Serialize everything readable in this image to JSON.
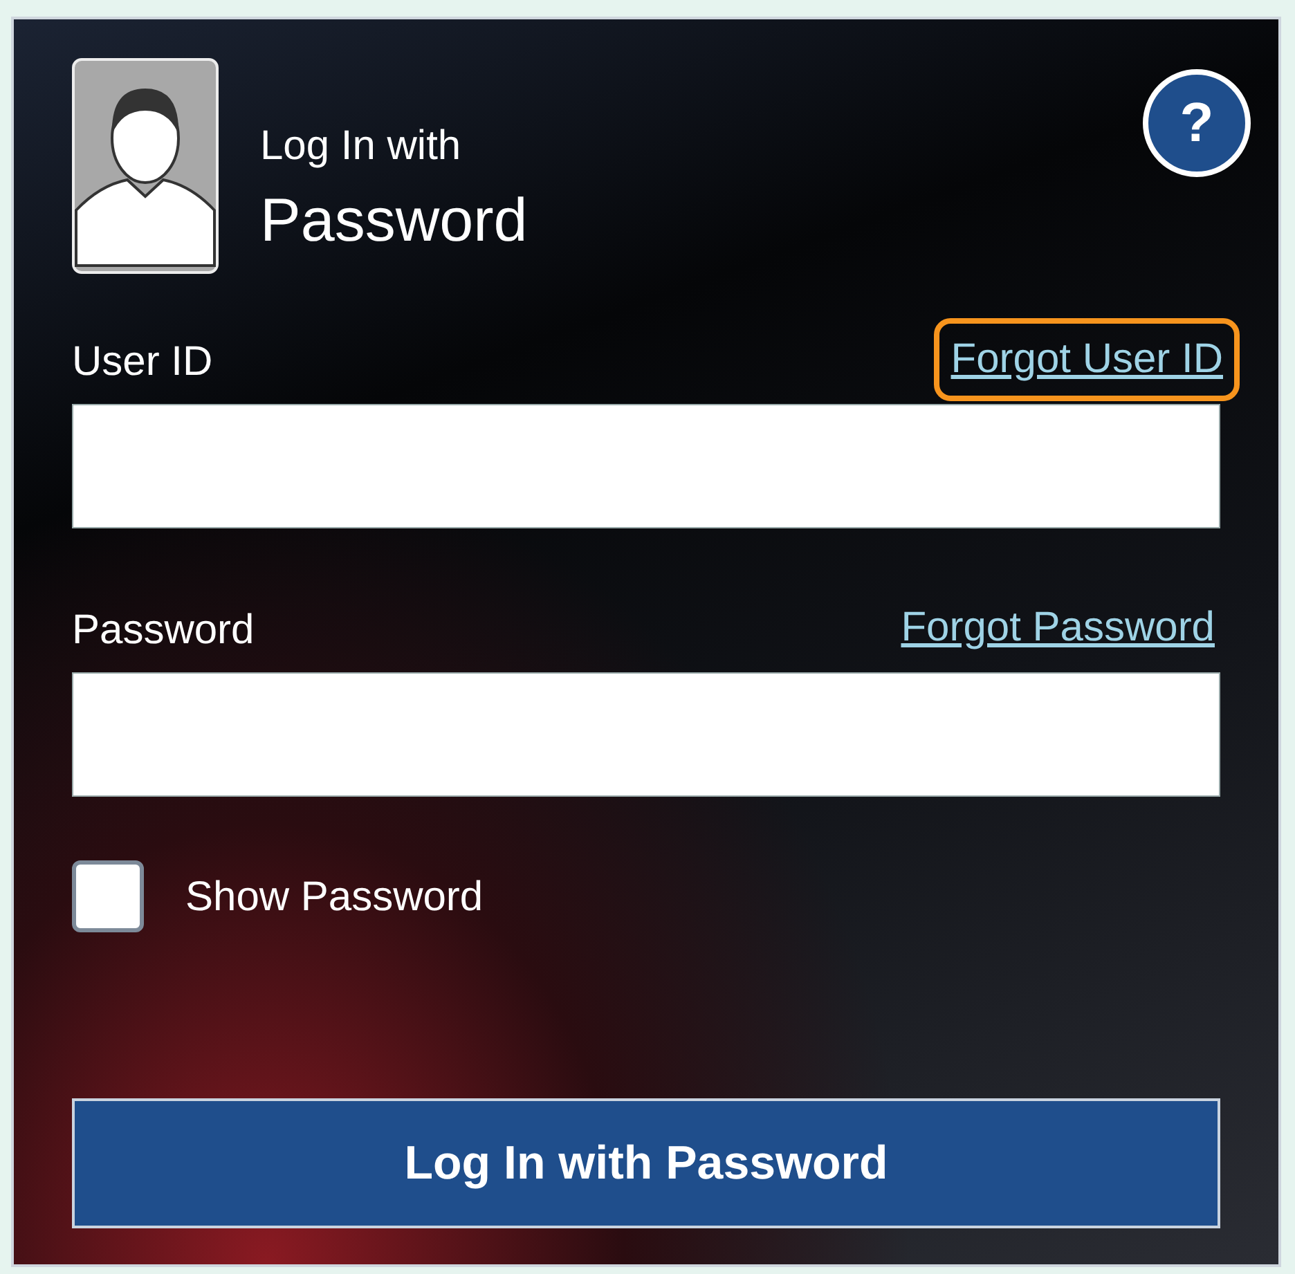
{
  "header": {
    "title_line_1": "Log In with",
    "title_line_2": "Password",
    "help": "?"
  },
  "fields": [
    {
      "label": "User ID",
      "link": "Forgot User ID",
      "link_highlighted": true
    },
    {
      "label": "Password",
      "link": "Forgot Password",
      "link_highlighted": false
    }
  ],
  "show_password": {
    "label": "Show Password",
    "checked": false
  },
  "submit": "Log In with Password"
}
